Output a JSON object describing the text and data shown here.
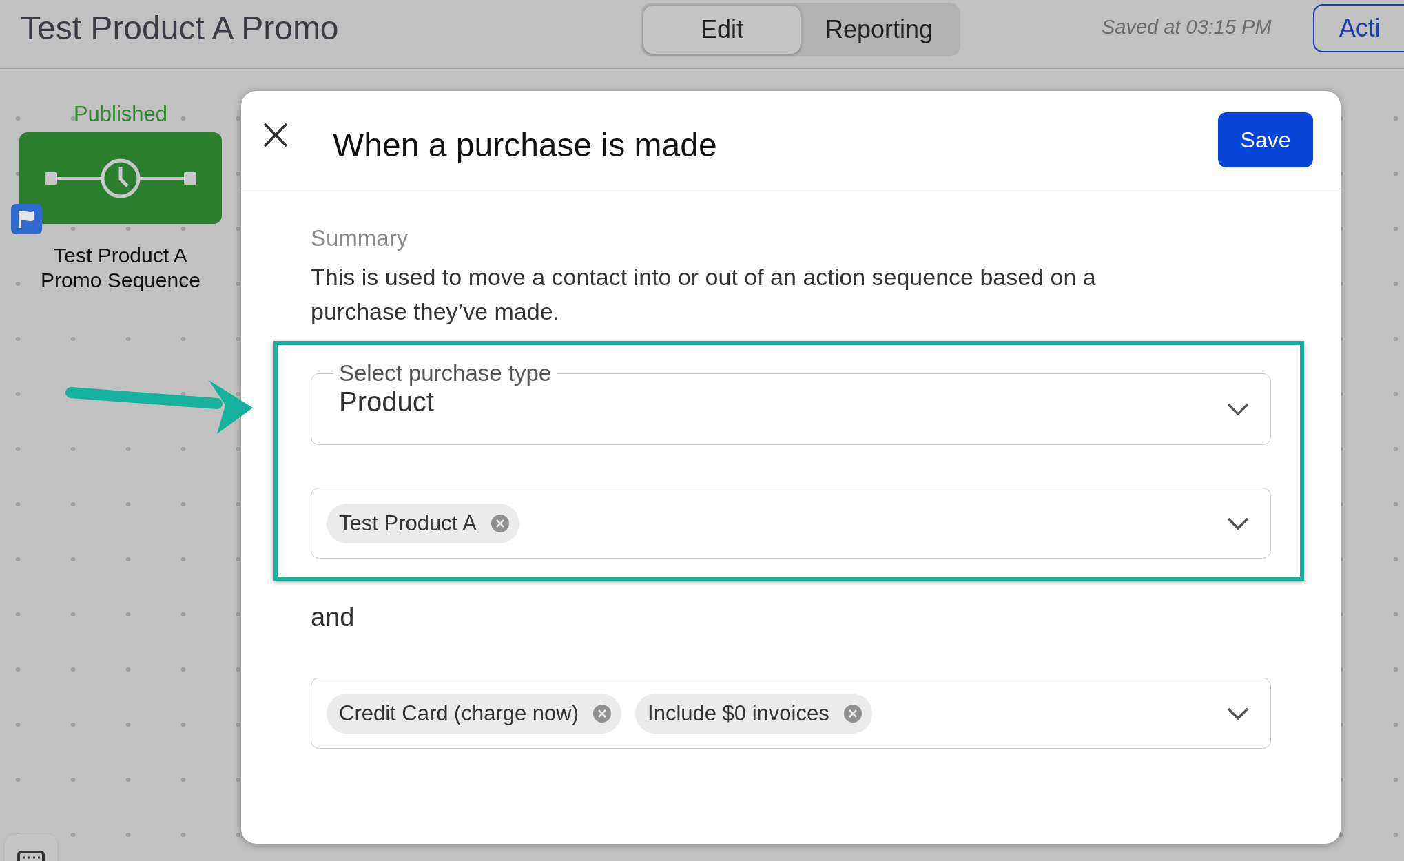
{
  "header": {
    "title": "Test Product A Promo",
    "tabs": [
      {
        "label": "Edit",
        "selected": true
      },
      {
        "label": "Reporting",
        "selected": false
      }
    ],
    "saved": "Saved at 03:15 PM",
    "action_button": "Acti"
  },
  "node": {
    "status": "Published",
    "name": "Test Product A Promo Sequence"
  },
  "modal": {
    "title": "When a purchase is made",
    "save": "Save",
    "summary_label": "Summary",
    "summary": "This is used to move a contact into or out of an action sequence based on a purchase they’ve made.",
    "highlighted_fields": [
      {
        "kind": "select",
        "label": "Select purchase type",
        "value": "Product"
      },
      {
        "kind": "chips",
        "chips": [
          "Test Product A"
        ]
      }
    ],
    "connector": "and",
    "fields": [
      {
        "kind": "chips",
        "chips": [
          "Credit Card (charge now)",
          "Include $0 invoices"
        ]
      }
    ]
  }
}
